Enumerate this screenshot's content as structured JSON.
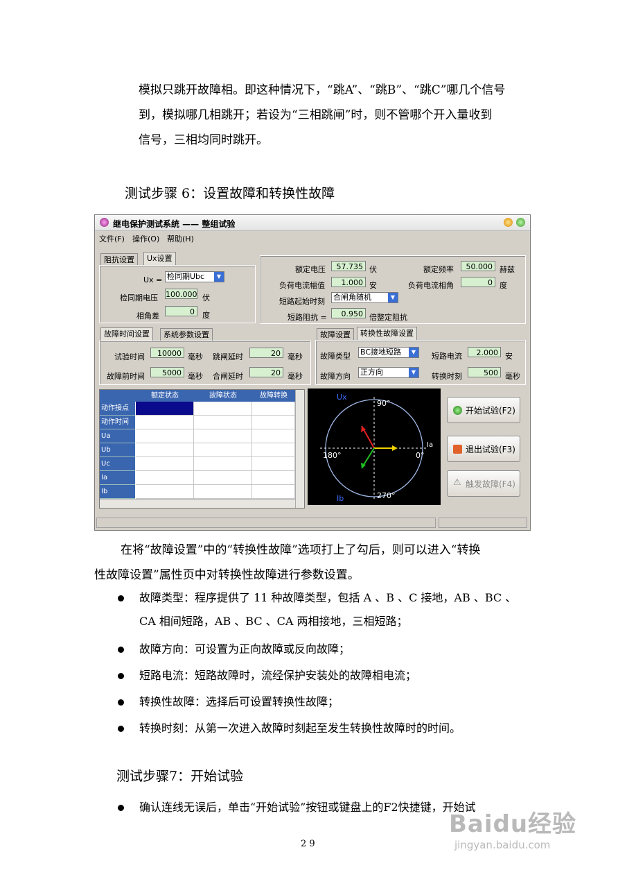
{
  "paragraphs": {
    "intro_line1": "模拟只跳开故障相。即这种情况下，“跳A”、“跳B”、“跳C”哪几个信号",
    "intro_line2": "到，模拟哪几相跳开；若设为“三相跳闸”时，则不管哪个开入量收到",
    "intro_line3": "信号，三相均同时跳开。",
    "step6_heading": "测试步骤 6：设置故障和转换性故障",
    "after_line1": "在将“故障设置”中的“转换性故障”选项打上了勾后，则可以进入“转换",
    "after_line2": "性故障设置”属性页中对转换性故障进行参数设置。",
    "bullets": [
      [
        "故障类型：程序提供了 11 种故障类型，包括 A 、B 、C 接地，AB 、BC 、",
        "CA 相间短路，AB 、BC 、CA 两相接地，三相短路；"
      ],
      [
        "故障方向：可设置为正向故障或反向故障；"
      ],
      [
        "短路电流：短路故障时，流经保护安装处的故障相电流；"
      ],
      [
        "转换性故障：选择后可设置转换性故障；"
      ],
      [
        "转换时刻：从第一次进入故障时刻起至发生转换性故障时的时间。"
      ]
    ],
    "step7_heading": "测试步骤7：开始试验",
    "step7_bullet": "确认连线无误后，单击“开始试验”按钮或键盘上的F2快捷键，开始试",
    "page_number": "2 9"
  },
  "window": {
    "title": "继电保护测试系统  ——  整组试验",
    "menu": [
      "文件(F)",
      "操作(O)",
      "帮助(H)"
    ],
    "tabs_top_left": [
      "阻抗设置",
      "Ux设置"
    ],
    "ux": {
      "ux_label": "Ux =",
      "ux_select": "检同期Ubc",
      "sync_voltage_label": "检同期电压",
      "sync_voltage": "100.000",
      "sync_voltage_unit": "伏",
      "angle_diff_label": "相角差",
      "angle_diff": "0",
      "angle_diff_unit": "度"
    },
    "rated": {
      "voltage_label": "额定电压",
      "voltage": "57.735",
      "voltage_unit": "伏",
      "freq_label": "额定频率",
      "freq": "50.000",
      "freq_unit": "赫兹",
      "load_current_label": "负荷电流幅值",
      "load_current": "1.000",
      "load_current_unit": "安",
      "load_angle_label": "负荷电流相角",
      "load_angle": "0",
      "load_angle_unit": "度",
      "start_label": "短路起始时刻",
      "start_select": "合闸角随机",
      "impedance_label": "短路阻抗 =",
      "impedance": "0.950",
      "impedance_unit": "倍整定阻抗"
    },
    "tabs_mid_left": [
      "故障时间设置",
      "系统参数设置"
    ],
    "timing": {
      "test_time_label": "试验时间",
      "test_time": "10000",
      "test_time_unit": "毫秒",
      "trip_delay_label": "跳闸延时",
      "trip_delay": "20",
      "trip_delay_unit": "毫秒",
      "prefault_label": "故障前时间",
      "prefault": "5000",
      "prefault_unit": "毫秒",
      "close_delay_label": "合闸延时",
      "close_delay": "20",
      "close_delay_unit": "毫秒"
    },
    "tabs_mid_right": [
      "故障设置",
      "转换性故障设置"
    ],
    "fault": {
      "type_label": "故障类型",
      "type": "BC接地短路",
      "current_label": "短路电流",
      "current": "2.000",
      "current_unit": "安",
      "direction_label": "故障方向",
      "direction": "正方向",
      "switch_time_label": "转换时刻",
      "switch_time": "500",
      "switch_time_unit": "毫秒"
    },
    "table": {
      "columns": [
        "额定状态",
        "故障状态",
        "故障转换"
      ],
      "rows": [
        "动作接点",
        "动作时间",
        "Ua",
        "Ub",
        "Uc",
        "Ia",
        "Ib"
      ]
    },
    "scope": {
      "top_label": "90°",
      "bottom_label": "270°",
      "left_label": "180°",
      "right_label": "0°",
      "ux_label": "Ux",
      "ia_label": "Ia",
      "ib_label": "Ib"
    },
    "buttons": {
      "start": "开始试验(F2)",
      "exit": "退出试验(F3)",
      "trigger": "触发故障(F4)"
    }
  },
  "watermark": {
    "brand": "Baidu经验",
    "url": "jingyan.baidu.com"
  }
}
